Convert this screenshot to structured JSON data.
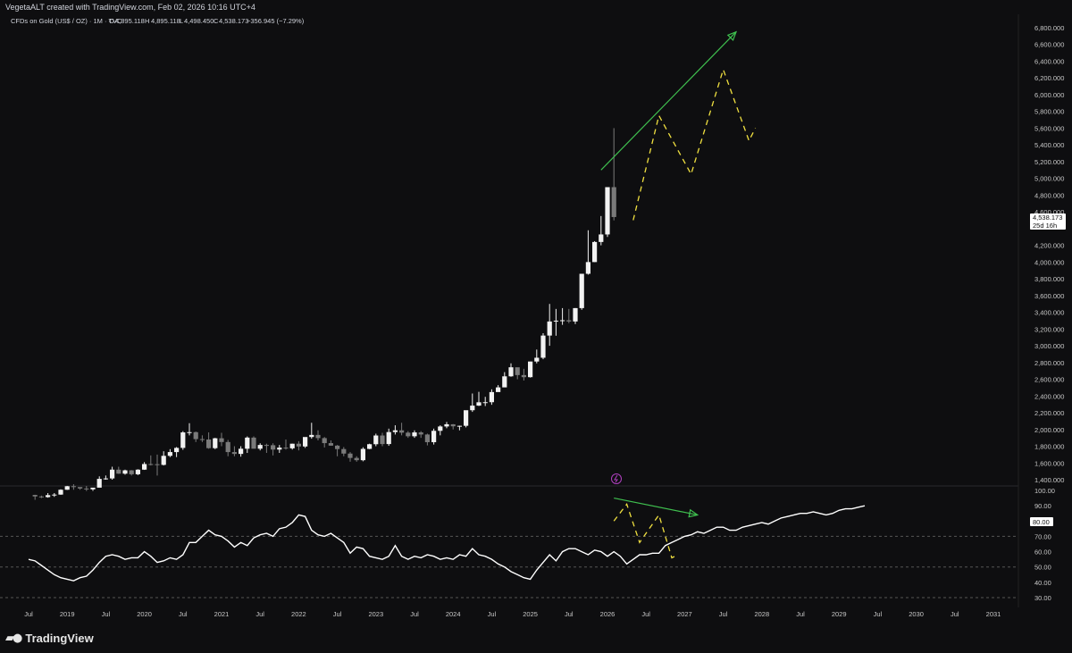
{
  "header": {
    "attribution": "VegetaALT created with TradingView.com, Feb 02, 2026 10:16 UTC+4"
  },
  "legend": {
    "symbol": "CFDs on Gold (US$ / OZ) · 1M · TVC",
    "o_label": "O",
    "o_value": "4,895.118",
    "h_label": "H",
    "h_value": "4,895.118",
    "l_label": "L",
    "l_value": "4,498.450",
    "c_label": "C",
    "c_value": "4,538.173",
    "change": "−356.945 (−7.29%)"
  },
  "price_badge": {
    "value": "4,538.173",
    "countdown": "25d 16h"
  },
  "rsi_badge": {
    "value": "80.00"
  },
  "brand": {
    "name": "TradingView"
  },
  "colors": {
    "background": "#0e0e10",
    "candle_up": "#f2f2f2",
    "candle_down": "#7a7a7a",
    "rsi_line": "#ffffff",
    "projection": "#f0e040",
    "trendline": "#3fbf4f",
    "grid_dash": "#555555",
    "alert_icon": "#b040c0"
  },
  "chart_data": {
    "type": "candlestick",
    "symbol": "CFDs on Gold (US$ / OZ)",
    "timeframe": "1M",
    "price_axis_ticks": [
      "6,800.000",
      "6,600.000",
      "6,400.000",
      "6,200.000",
      "6,000.000",
      "5,800.000",
      "5,600.000",
      "5,400.000",
      "5,200.000",
      "5,000.000",
      "4,800.000",
      "4,600.000",
      "4,200.000",
      "4,000.000",
      "3,800.000",
      "3,600.000",
      "3,400.000",
      "3,200.000",
      "3,000.000",
      "2,800.000",
      "2,600.000",
      "2,400.000",
      "2,200.000",
      "2,000.000",
      "1,800.000",
      "1,600.000",
      "1,400.000"
    ],
    "rsi_axis_ticks": [
      "100.00",
      "90.00",
      "70.00",
      "60.00",
      "50.00",
      "40.00",
      "30.00"
    ],
    "time_axis_ticks": [
      "Jul",
      "2019",
      "Jul",
      "2020",
      "Jul",
      "2021",
      "Jul",
      "2022",
      "Jul",
      "2023",
      "Jul",
      "2024",
      "Jul",
      "2025",
      "Jul",
      "2026",
      "Jul",
      "2027",
      "Jul",
      "2028",
      "Jul",
      "2029",
      "Jul",
      "2030",
      "Jul",
      "2031"
    ],
    "time_range": [
      "2018-07",
      "2031-06"
    ],
    "price_range": [
      1400,
      6800
    ],
    "rsi_range": [
      30,
      100
    ],
    "rsi_levels": [
      70,
      50,
      30
    ],
    "candles_start": "2018-08",
    "candles": [
      [
        1218,
        1220,
        1160,
        1200
      ],
      [
        1200,
        1210,
        1180,
        1192
      ],
      [
        1192,
        1240,
        1185,
        1215
      ],
      [
        1215,
        1240,
        1195,
        1222
      ],
      [
        1222,
        1285,
        1220,
        1280
      ],
      [
        1280,
        1326,
        1278,
        1322
      ],
      [
        1322,
        1346,
        1280,
        1312
      ],
      [
        1312,
        1310,
        1280,
        1295
      ],
      [
        1295,
        1325,
        1265,
        1285
      ],
      [
        1285,
        1290,
        1267,
        1305
      ],
      [
        1305,
        1440,
        1310,
        1410
      ],
      [
        1410,
        1450,
        1400,
        1415
      ],
      [
        1415,
        1555,
        1400,
        1520
      ],
      [
        1520,
        1555,
        1470,
        1472
      ],
      [
        1472,
        1520,
        1460,
        1512
      ],
      [
        1512,
        1515,
        1450,
        1465
      ],
      [
        1465,
        1525,
        1455,
        1520
      ],
      [
        1520,
        1610,
        1517,
        1587
      ],
      [
        1587,
        1690,
        1570,
        1585
      ],
      [
        1585,
        1700,
        1450,
        1577
      ],
      [
        1577,
        1740,
        1570,
        1685
      ],
      [
        1685,
        1765,
        1670,
        1730
      ],
      [
        1730,
        1790,
        1670,
        1780
      ],
      [
        1780,
        1980,
        1757,
        1965
      ],
      [
        1965,
        2075,
        1930,
        1968
      ],
      [
        1968,
        1975,
        1850,
        1885
      ],
      [
        1885,
        1930,
        1850,
        1880
      ],
      [
        1880,
        1965,
        1770,
        1777
      ],
      [
        1777,
        1900,
        1765,
        1895
      ],
      [
        1895,
        1960,
        1800,
        1850
      ],
      [
        1850,
        1875,
        1680,
        1730
      ],
      [
        1730,
        1800,
        1680,
        1708
      ],
      [
        1708,
        1800,
        1675,
        1770
      ],
      [
        1770,
        1917,
        1720,
        1903
      ],
      [
        1903,
        1917,
        1780,
        1770
      ],
      [
        1770,
        1835,
        1750,
        1815
      ],
      [
        1815,
        1830,
        1720,
        1812
      ],
      [
        1812,
        1835,
        1690,
        1760
      ],
      [
        1760,
        1815,
        1720,
        1783
      ],
      [
        1783,
        1880,
        1760,
        1775
      ],
      [
        1775,
        1830,
        1760,
        1830
      ],
      [
        1830,
        1860,
        1750,
        1797
      ],
      [
        1797,
        1830,
        1780,
        1910
      ],
      [
        1910,
        2080,
        1890,
        1935
      ],
      [
        1935,
        1990,
        1870,
        1897
      ],
      [
        1897,
        1910,
        1785,
        1837
      ],
      [
        1837,
        1870,
        1805,
        1807
      ],
      [
        1807,
        1815,
        1680,
        1766
      ],
      [
        1766,
        1790,
        1680,
        1712
      ],
      [
        1712,
        1730,
        1615,
        1660
      ],
      [
        1660,
        1680,
        1615,
        1633
      ],
      [
        1633,
        1787,
        1620,
        1768
      ],
      [
        1768,
        1830,
        1765,
        1824
      ],
      [
        1824,
        1950,
        1800,
        1928
      ],
      [
        1928,
        1960,
        1800,
        1826
      ],
      [
        1826,
        2010,
        1805,
        1969
      ],
      [
        1969,
        2050,
        1940,
        1990
      ],
      [
        1990,
        2080,
        1930,
        1962
      ],
      [
        1962,
        1980,
        1900,
        1919
      ],
      [
        1919,
        1990,
        1900,
        1965
      ],
      [
        1965,
        1980,
        1900,
        1940
      ],
      [
        1940,
        1950,
        1810,
        1848
      ],
      [
        1848,
        2010,
        1820,
        1984
      ],
      [
        1984,
        2050,
        1930,
        2036
      ],
      [
        2036,
        2090,
        2015,
        2062
      ],
      [
        2062,
        2065,
        2000,
        2038
      ],
      [
        2038,
        2045,
        1990,
        2044
      ],
      [
        2044,
        2200,
        2025,
        2230
      ],
      [
        2230,
        2430,
        2210,
        2285
      ],
      [
        2285,
        2450,
        2280,
        2325
      ],
      [
        2325,
        2390,
        2280,
        2326
      ],
      [
        2326,
        2480,
        2295,
        2447
      ],
      [
        2447,
        2530,
        2460,
        2503
      ],
      [
        2503,
        2685,
        2590,
        2635
      ],
      [
        2635,
        2790,
        2630,
        2743
      ],
      [
        2743,
        2700,
        2600,
        2650
      ],
      [
        2650,
        2725,
        2585,
        2625
      ],
      [
        2625,
        2810,
        2620,
        2812
      ],
      [
        2812,
        2955,
        2790,
        2857
      ],
      [
        2857,
        3150,
        2840,
        3122
      ],
      [
        3122,
        3500,
        3000,
        3290
      ],
      [
        3290,
        3440,
        3120,
        3300
      ],
      [
        3300,
        3450,
        3250,
        3305
      ],
      [
        3305,
        3440,
        3270,
        3290
      ],
      [
        3290,
        3450,
        3260,
        3450
      ],
      [
        3450,
        3860,
        3430,
        3860
      ],
      [
        3860,
        4380,
        3850,
        4000
      ],
      [
        4000,
        4250,
        4000,
        4240
      ],
      [
        4240,
        4550,
        4200,
        4330
      ],
      [
        4330,
        4895,
        4300,
        4895
      ],
      [
        4895,
        5600,
        4498,
        4538
      ]
    ],
    "rsi": [
      55,
      54,
      51,
      48,
      45,
      43,
      42,
      41,
      43,
      44,
      48,
      53,
      57,
      58,
      57,
      55,
      56,
      56,
      60,
      57,
      53,
      54,
      56,
      55,
      58,
      66,
      66,
      70,
      74,
      71,
      70,
      67,
      63,
      66,
      64,
      69,
      71,
      72,
      70,
      75,
      76,
      79,
      84,
      83,
      74,
      71,
      70,
      72,
      69,
      66,
      59,
      63,
      62,
      57,
      56,
      55,
      57,
      64,
      57,
      55,
      57,
      56,
      58,
      57,
      55,
      56,
      55,
      58,
      57,
      62,
      58,
      57,
      55,
      52,
      50,
      47,
      45,
      43,
      42,
      48,
      53,
      58,
      54,
      60,
      62,
      62,
      60,
      58,
      61,
      60,
      57,
      60,
      57,
      52,
      55,
      58,
      58,
      59,
      59,
      64,
      66,
      68,
      70,
      71,
      73,
      72,
      74,
      76,
      76,
      74,
      74,
      76,
      77,
      78,
      79,
      78,
      80,
      82,
      83,
      84,
      85,
      85,
      86,
      85,
      84,
      85,
      87,
      88,
      88,
      89,
      90
    ],
    "projection_price": [
      [
        "2026-05",
        4500
      ],
      [
        "2026-09",
        5750
      ],
      [
        "2027-02",
        5050
      ],
      [
        "2027-07",
        6300
      ],
      [
        "2027-11",
        5450
      ],
      [
        "2027-12",
        5600
      ]
    ],
    "projection_rsi": [
      [
        "2026-02",
        80
      ],
      [
        "2026-04",
        91
      ],
      [
        "2026-06",
        66
      ],
      [
        "2026-09",
        84
      ],
      [
        "2026-11",
        56
      ],
      [
        "2026-12",
        58
      ]
    ],
    "trendline_price": [
      [
        "2025-12",
        5100
      ],
      [
        "2027-09",
        6750
      ]
    ],
    "trendline_rsi": [
      [
        "2026-02",
        95
      ],
      [
        "2027-03",
        84
      ]
    ]
  }
}
